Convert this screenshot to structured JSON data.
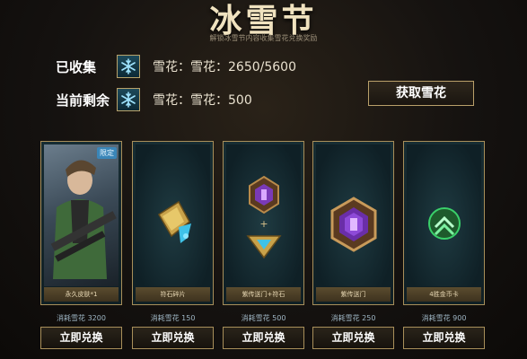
{
  "header": {
    "title": "冰雪节",
    "subtitle": "解锁冰雪节内容收集雪花兑换奖励"
  },
  "stats": {
    "collected": {
      "label": "已收集",
      "value": "雪花：雪花：2650/5600"
    },
    "remaining": {
      "label": "当前剩余",
      "value": "雪花：雪花：500"
    }
  },
  "get_button": "获取雪花",
  "cards": [
    {
      "name": "永久皮肤*1",
      "cost": "消耗雪花 3200",
      "button": "立即兑换",
      "badge": "限定",
      "icon": "hero-skin-art"
    },
    {
      "name": "符石碎片",
      "cost": "消耗雪花 150",
      "button": "立即兑换",
      "icon": "rune-shard-icon"
    },
    {
      "name": "紫传送门+符石",
      "cost": "消耗雪花 500",
      "button": "立即兑换",
      "icon": "purple-portal-rune-icon"
    },
    {
      "name": "紫传送门",
      "cost": "消耗雪花 250",
      "button": "立即兑换",
      "icon": "purple-portal-icon"
    },
    {
      "name": "4胜金币卡",
      "cost": "消耗雪花 900",
      "button": "立即兑换",
      "icon": "gold-card-icon"
    }
  ],
  "colors": {
    "gold": "#b9a06a",
    "panel": "#172d33",
    "snowflake": "#9fe4ff"
  }
}
